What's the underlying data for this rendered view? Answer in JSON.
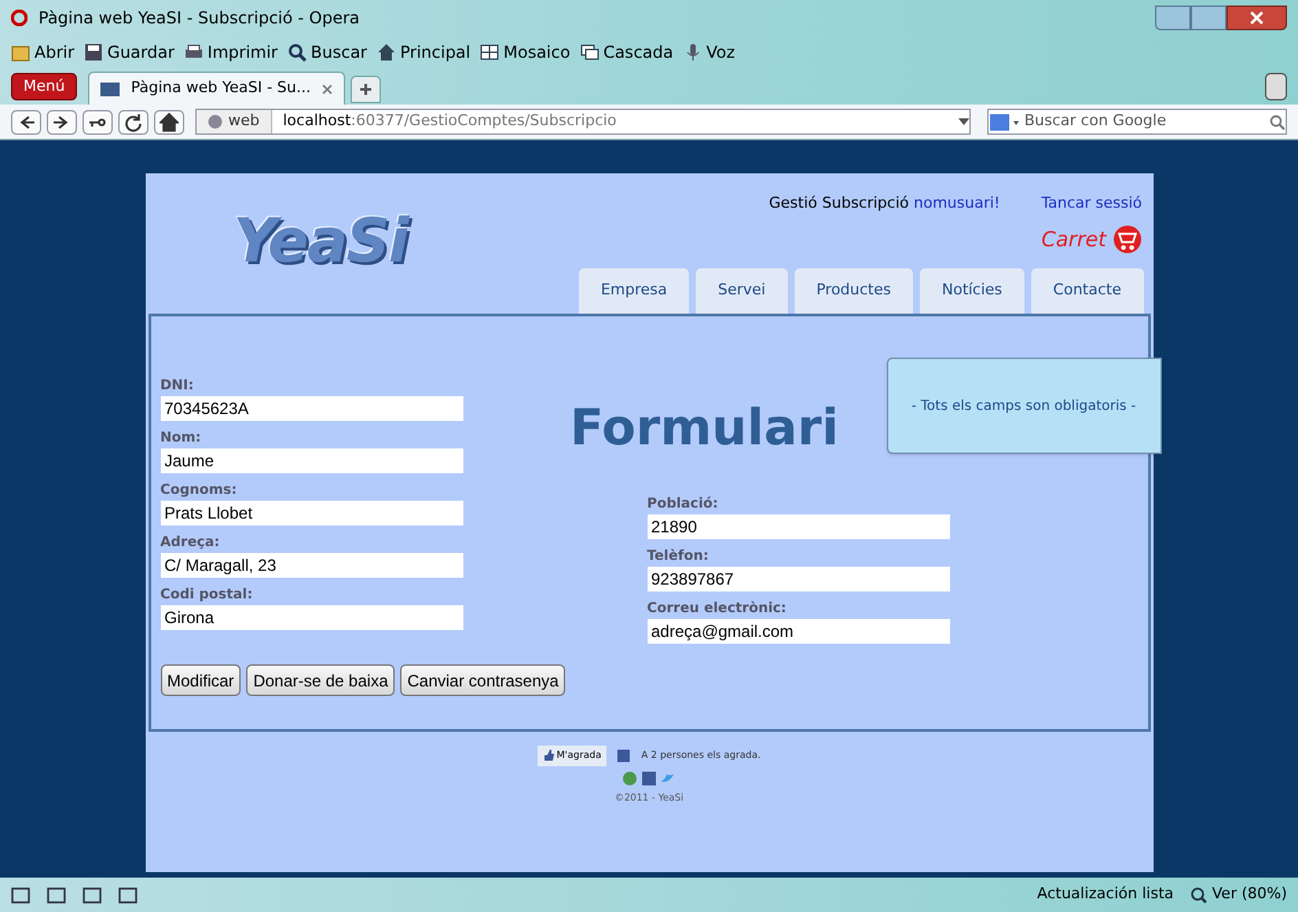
{
  "window": {
    "title": "Pàgina web YeaSI - Subscripció - Opera"
  },
  "toolbar": [
    {
      "label": "Abrir"
    },
    {
      "label": "Guardar"
    },
    {
      "label": "Imprimir"
    },
    {
      "label": "Buscar"
    },
    {
      "label": "Principal"
    },
    {
      "label": "Mosaico"
    },
    {
      "label": "Cascada"
    },
    {
      "label": "Voz"
    }
  ],
  "menu_button": "Menú",
  "tabs": [
    {
      "label": "Pàgina web YeaSI - Su...",
      "selected": true
    }
  ],
  "address": {
    "badge": "web",
    "host": "localhost",
    "path": ":60377/GestioComptes/Subscripcio"
  },
  "search": {
    "placeholder": "Buscar con Google"
  },
  "page": {
    "logo": "YeaSi",
    "greeting": "Gestió Subscripció",
    "user": "nomusuari!",
    "logout": "Tancar sessió",
    "cart": "Carret",
    "nav": [
      {
        "label": "Empresa"
      },
      {
        "label": "Servei"
      },
      {
        "label": "Productes"
      },
      {
        "label": "Notícies"
      },
      {
        "label": "Contacte"
      }
    ],
    "form_title": "Formulari",
    "notice": "- Tots els camps son obligatoris -",
    "left_fields": [
      {
        "label": "DNI:",
        "value": "70345623A"
      },
      {
        "label": "Nom:",
        "value": "Jaume"
      },
      {
        "label": "Cognoms:",
        "value": "Prats Llobet"
      },
      {
        "label": "Adreça:",
        "value": "C/ Maragall, 23"
      },
      {
        "label": "Codi postal:",
        "value": "Girona"
      }
    ],
    "right_fields": [
      {
        "label": "Població:",
        "value": "21890"
      },
      {
        "label": "Telèfon:",
        "value": "923897867"
      },
      {
        "label": "Correu electrònic:",
        "value": "adreça@gmail.com"
      }
    ],
    "buttons": [
      "Modificar",
      "Donar-se de baixa",
      "Canviar contrasenya"
    ],
    "like_button": "M'agrada",
    "like_text": "A 2 persones els agrada.",
    "copyright": "©2011 - YeaSi"
  },
  "status_bar": {
    "status": "Actualización lista",
    "zoom": "Ver (80%)"
  }
}
